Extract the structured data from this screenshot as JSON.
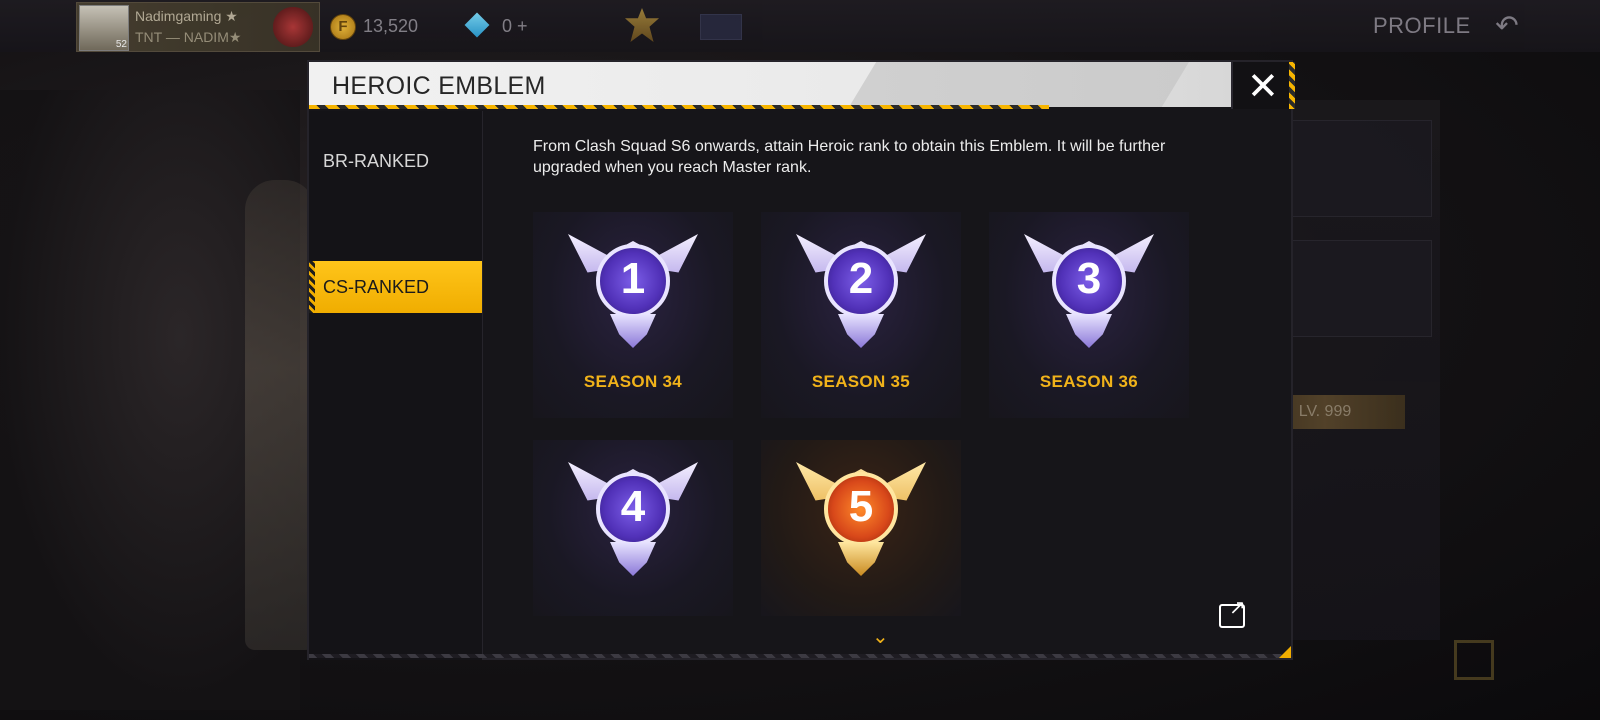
{
  "player": {
    "name": "Nadimgaming ★",
    "guild": "TNT — NADIM★",
    "level": "52"
  },
  "currency": {
    "coins": "13,520",
    "diamonds": "0 +"
  },
  "header": {
    "profile_label": "PROFILE"
  },
  "background": {
    "level_badge": "LV. 999"
  },
  "modal": {
    "title": "HEROIC EMBLEM",
    "close_label": "✕",
    "tabs": [
      {
        "label": "BR-RANKED",
        "active": false
      },
      {
        "label": "CS-RANKED",
        "active": true
      }
    ],
    "description": "From Clash Squad S6 onwards, attain Heroic rank to obtain this Emblem. It will be further upgraded when you reach Master rank.",
    "emblems": [
      {
        "number": "1",
        "label": "SEASON 34",
        "style": "purple"
      },
      {
        "number": "2",
        "label": "SEASON 35",
        "style": "purple"
      },
      {
        "number": "3",
        "label": "SEASON 36",
        "style": "purple"
      },
      {
        "number": "4",
        "label": "",
        "style": "purple"
      },
      {
        "number": "5",
        "label": "",
        "style": "gold"
      }
    ]
  },
  "colors": {
    "accent": "#f0ad00",
    "season_text": "#f0b21a"
  }
}
